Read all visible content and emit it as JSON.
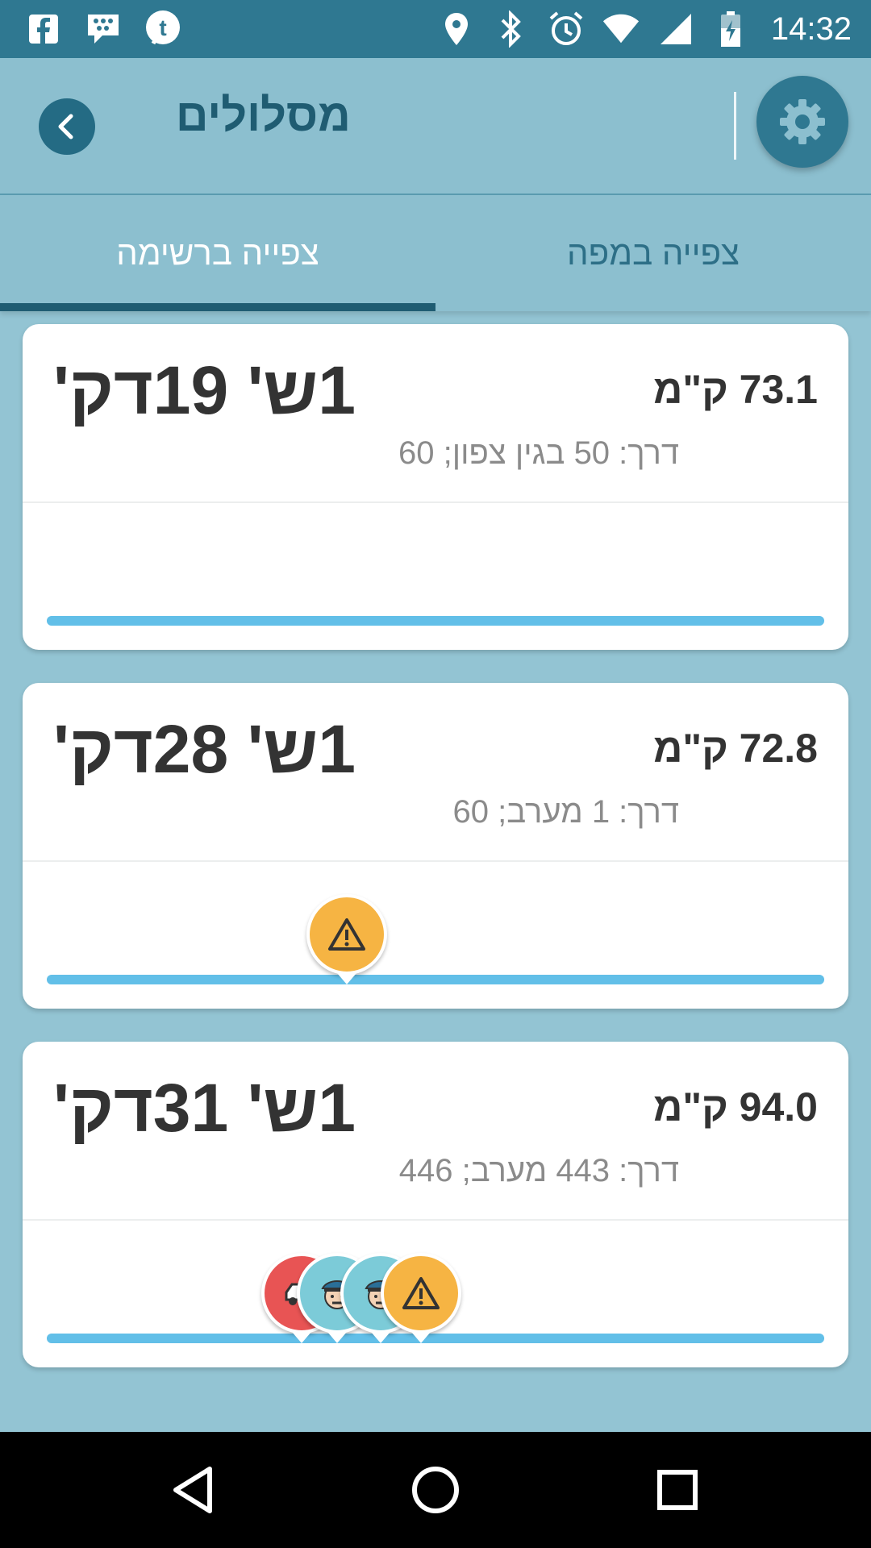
{
  "status_bar": {
    "time": "14:32",
    "left_icons": [
      "facebook-icon",
      "blackberry-icon",
      "tumblr-icon"
    ],
    "right_icons": [
      "location-icon",
      "bluetooth-icon",
      "alarm-icon",
      "wifi-icon",
      "cell-signal-icon",
      "battery-icon"
    ]
  },
  "header": {
    "title": "מסלולים"
  },
  "tabs": [
    {
      "label": "צפייה ברשימה",
      "selected": true
    },
    {
      "label": "צפייה במפה",
      "selected": false
    }
  ],
  "routes": [
    {
      "eta": "1ש' 19דק'",
      "distance": "73.1 ק\"מ",
      "road": "דרך: 50 בגין צפון; 60",
      "alerts": []
    },
    {
      "eta": "1ש' 28דק'",
      "distance": "72.8 ק\"מ",
      "road": "דרך: 1 מערב; 60",
      "alerts": [
        "hazard"
      ]
    },
    {
      "eta": "1ש' 31דק'",
      "distance": "94.0 ק\"מ",
      "road": "דרך: 443 מערב; 446",
      "alerts": [
        "accident",
        "police",
        "police",
        "hazard"
      ]
    }
  ],
  "colors": {
    "primary_dark": "#2f7891",
    "primary": "#8cbfcf",
    "background": "#93c4d3",
    "progress": "#62bfe8",
    "hazard": "#f6b443",
    "police": "#7ccbd8",
    "accident": "#e85454"
  }
}
